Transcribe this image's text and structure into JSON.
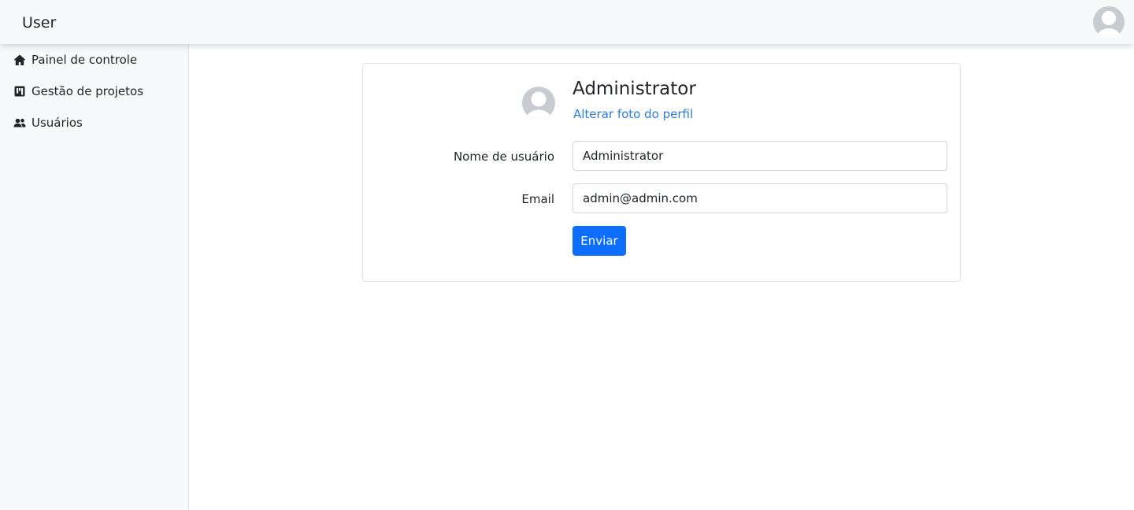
{
  "header": {
    "brand": "User",
    "avatar_icon": "user-avatar-icon"
  },
  "sidebar": {
    "items": [
      {
        "label": "Painel de controle",
        "icon": "home-icon"
      },
      {
        "label": "Gestão de projetos",
        "icon": "kanban-board-icon"
      },
      {
        "label": "Usuários",
        "icon": "users-icon"
      }
    ]
  },
  "profile": {
    "name": "Administrator",
    "change_photo_label": "Alterar foto do perfil",
    "avatar_icon": "user-avatar-icon",
    "username_label": "Nome de usuário",
    "username_value": "Administrator",
    "email_label": "Email",
    "email_value": "admin@admin.com",
    "submit_label": "Enviar"
  },
  "colors": {
    "primary": "#0d6efd",
    "link": "#2c7be5",
    "sidebar_bg": "#f8f9fa",
    "avatar_gray": "#c8ccd0"
  }
}
